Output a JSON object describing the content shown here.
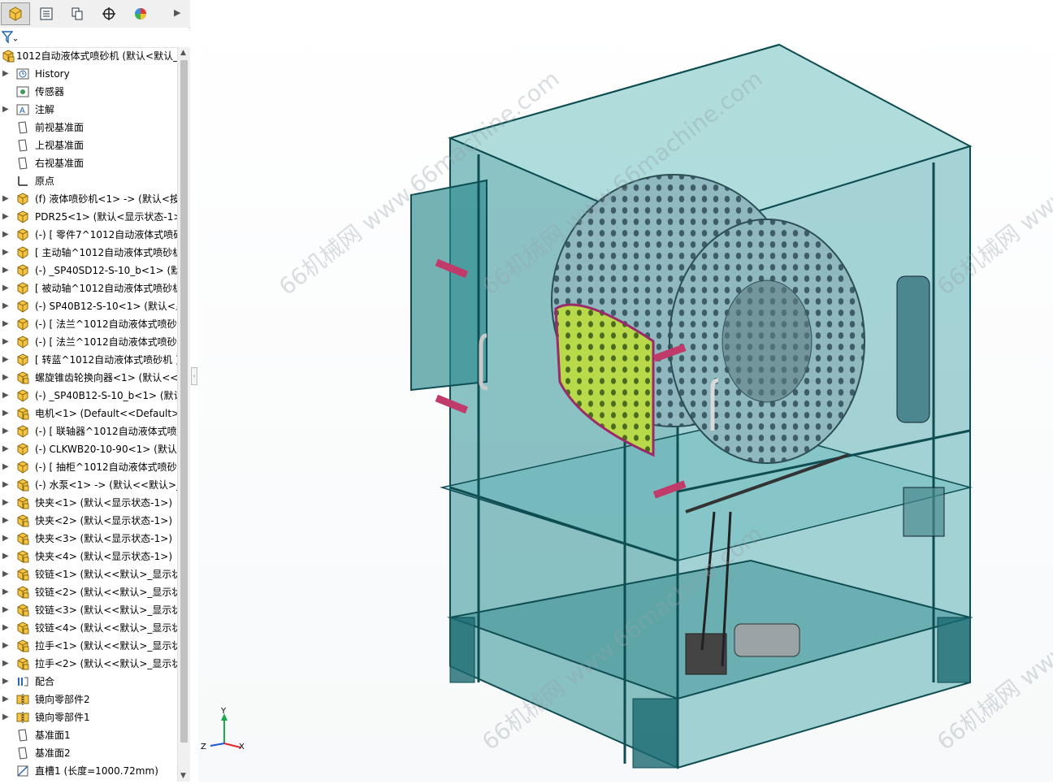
{
  "feature_manager": {
    "tabs": [
      {
        "name": "feature-manager-tab",
        "icon": "cube-icon"
      },
      {
        "name": "property-manager-tab",
        "icon": "list-icon"
      },
      {
        "name": "configuration-manager-tab",
        "icon": "config-icon"
      },
      {
        "name": "dimxpert-tab",
        "icon": "crosshair-icon"
      },
      {
        "name": "display-manager-tab",
        "icon": "color-wheel-icon"
      }
    ],
    "root_label": "1012自动液体式喷砂机 (默认<默认_",
    "items": [
      {
        "label": "History",
        "icon": "history-icon",
        "expandable": true
      },
      {
        "label": "传感器",
        "icon": "sensor-icon",
        "expandable": false
      },
      {
        "label": "注解",
        "icon": "annotation-icon",
        "expandable": true
      },
      {
        "label": "前视基准面",
        "icon": "plane-icon",
        "expandable": false
      },
      {
        "label": "上视基准面",
        "icon": "plane-icon",
        "expandable": false
      },
      {
        "label": "右视基准面",
        "icon": "plane-icon",
        "expandable": false
      },
      {
        "label": "原点",
        "icon": "origin-icon",
        "expandable": false
      },
      {
        "label": "(f) 液体喷砂机<1> -> (默认<按",
        "icon": "part-icon",
        "expandable": true
      },
      {
        "label": "PDR25<1> (默认<显示状态-1>",
        "icon": "part-icon",
        "expandable": true
      },
      {
        "label": "(-) [ 零件7^1012自动液体式喷砂",
        "icon": "part-icon",
        "expandable": true
      },
      {
        "label": "[ 主动轴^1012自动液体式喷砂机",
        "icon": "part-icon",
        "expandable": true
      },
      {
        "label": "(-) _SP40SD12-S-10_b<1> (默认",
        "icon": "part-icon",
        "expandable": true
      },
      {
        "label": "[ 被动轴^1012自动液体式喷砂机",
        "icon": "part-icon",
        "expandable": true
      },
      {
        "label": "(-) SP40B12-S-10<1> (默认<显",
        "icon": "part-icon",
        "expandable": true
      },
      {
        "label": "(-) [ 法兰^1012自动液体式喷砂机",
        "icon": "part-icon",
        "expandable": true
      },
      {
        "label": "(-) [ 法兰^1012自动液体式喷砂机",
        "icon": "part-icon",
        "expandable": true
      },
      {
        "label": "[ 转蓝^1012自动液体式喷砂机 ]",
        "icon": "part-icon",
        "expandable": true
      },
      {
        "label": "螺旋锥齿轮换向器<1> (默认<<默",
        "icon": "assembly-icon",
        "expandable": true
      },
      {
        "label": "(-) _SP40B12-S-10_b<1> (默认",
        "icon": "part-icon",
        "expandable": true
      },
      {
        "label": "电机<1> (Default<<Default>_F",
        "icon": "assembly-icon",
        "expandable": true
      },
      {
        "label": "(-) [ 联轴器^1012自动液体式喷砂",
        "icon": "part-icon",
        "expandable": true
      },
      {
        "label": "(-) CLKWB20-10-90<1> (默认<",
        "icon": "part-icon",
        "expandable": true
      },
      {
        "label": "(-) [ 抽柜^1012自动液体式喷砂机",
        "icon": "part-icon",
        "expandable": true
      },
      {
        "label": "(-) 水泵<1> -> (默认<<默认>_显",
        "icon": "assembly-icon",
        "expandable": true
      },
      {
        "label": "快夹<1> (默认<显示状态-1>)",
        "icon": "assembly-icon",
        "expandable": true
      },
      {
        "label": "快夹<2> (默认<显示状态-1>)",
        "icon": "assembly-icon",
        "expandable": true
      },
      {
        "label": "快夹<3> (默认<显示状态-1>)",
        "icon": "assembly-icon",
        "expandable": true
      },
      {
        "label": "快夹<4> (默认<显示状态-1>)",
        "icon": "assembly-icon",
        "expandable": true
      },
      {
        "label": "铰链<1> (默认<<默认>_显示状",
        "icon": "assembly-icon",
        "expandable": true
      },
      {
        "label": "铰链<2> (默认<<默认>_显示状",
        "icon": "assembly-icon",
        "expandable": true
      },
      {
        "label": "铰链<3> (默认<<默认>_显示状",
        "icon": "assembly-icon",
        "expandable": true
      },
      {
        "label": "铰链<4> (默认<<默认>_显示状",
        "icon": "assembly-icon",
        "expandable": true
      },
      {
        "label": "拉手<1> (默认<<默认>_显示状",
        "icon": "assembly-icon",
        "expandable": true
      },
      {
        "label": "拉手<2> (默认<<默认>_显示状",
        "icon": "assembly-icon",
        "expandable": true
      },
      {
        "label": "配合",
        "icon": "mates-icon",
        "expandable": true
      },
      {
        "label": "镜向零部件2",
        "icon": "mirror-icon",
        "expandable": true
      },
      {
        "label": "镜向零部件1",
        "icon": "mirror-icon",
        "expandable": true
      },
      {
        "label": "基准面1",
        "icon": "plane-icon",
        "expandable": false
      },
      {
        "label": "基准面2",
        "icon": "plane-icon",
        "expandable": false
      },
      {
        "label": "直槽1 (长度=1000.72mm)",
        "icon": "sketch-icon",
        "expandable": false
      }
    ]
  },
  "watermark": {
    "text": "66机械网 www.66machine.com"
  },
  "triad": {
    "x_label": "X",
    "y_label": "Y",
    "z_label": "Z"
  },
  "colors": {
    "cabinet": "#1f8a8a",
    "cabinet_fill": "#5fb8b8",
    "frame": "#0e4d52",
    "drum": "#7fb0b8",
    "handle": "#c03a6a"
  }
}
